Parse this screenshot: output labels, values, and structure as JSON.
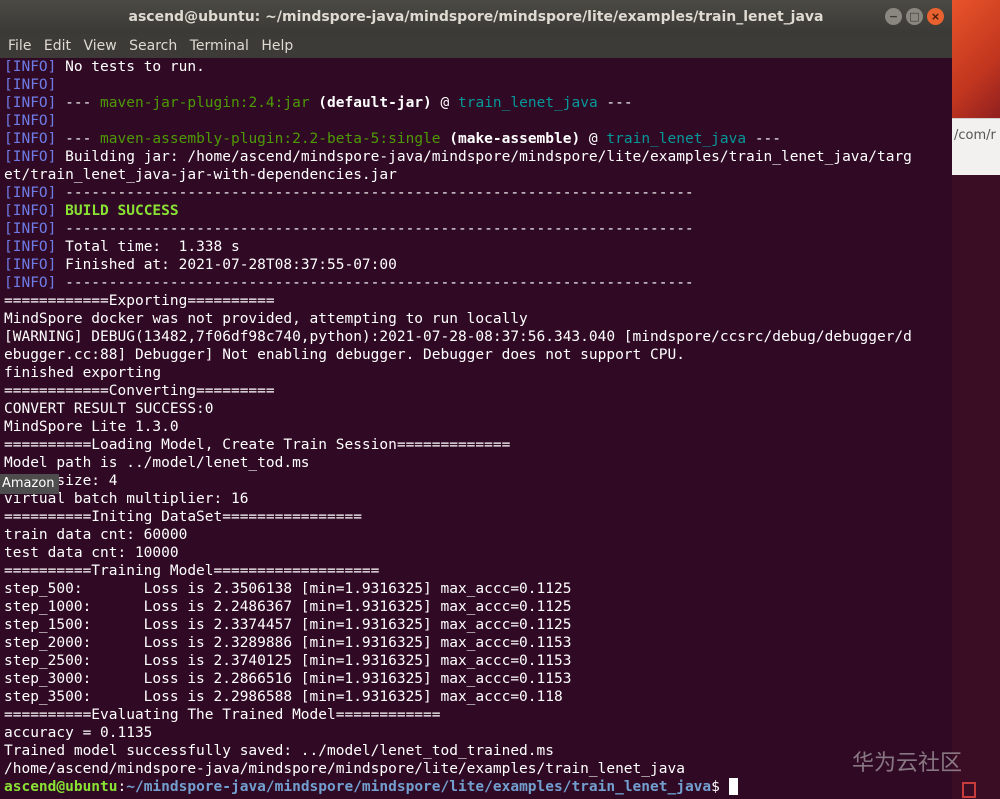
{
  "window": {
    "title": "ascend@ubuntu: ~/mindspore-java/mindspore/mindspore/lite/examples/train_lenet_java",
    "buttons": [
      "−",
      "□",
      "×"
    ]
  },
  "menu": [
    "File",
    "Edit",
    "View",
    "Search",
    "Terminal",
    "Help"
  ],
  "background": {
    "url_fragment": "/com/r"
  },
  "overlay_label": "Amazon",
  "watermark": "华为云社区",
  "lines": [
    [
      [
        "info",
        "[INFO]"
      ],
      [
        "t",
        " No tests to run."
      ]
    ],
    [
      [
        "info",
        "[INFO]"
      ]
    ],
    [
      [
        "info",
        "[INFO]"
      ],
      [
        "t",
        " --- "
      ],
      [
        "green",
        "maven-jar-plugin:2.4:jar"
      ],
      [
        "t",
        " "
      ],
      [
        "bold",
        "(default-jar)"
      ],
      [
        "t",
        " @ "
      ],
      [
        "cyan",
        "train_lenet_java"
      ],
      [
        "t",
        " ---"
      ]
    ],
    [
      [
        "info",
        "[INFO]"
      ]
    ],
    [
      [
        "info",
        "[INFO]"
      ],
      [
        "t",
        " --- "
      ],
      [
        "green",
        "maven-assembly-plugin:2.2-beta-5:single"
      ],
      [
        "t",
        " "
      ],
      [
        "bold",
        "(make-assemble)"
      ],
      [
        "t",
        " @ "
      ],
      [
        "cyan",
        "train_lenet_java"
      ],
      [
        "t",
        " ---"
      ]
    ],
    [
      [
        "info",
        "[INFO]"
      ],
      [
        "t",
        " Building jar: /home/ascend/mindspore-java/mindspore/mindspore/lite/examples/train_lenet_java/targ"
      ]
    ],
    [
      [
        "t",
        "et/train_lenet_java-jar-with-dependencies.jar"
      ]
    ],
    [
      [
        "info",
        "[INFO]"
      ],
      [
        "t",
        " ------------------------------------------------------------------------"
      ]
    ],
    [
      [
        "info",
        "[INFO]"
      ],
      [
        "t",
        " "
      ],
      [
        "lgreen",
        "BUILD SUCCESS"
      ]
    ],
    [
      [
        "info",
        "[INFO]"
      ],
      [
        "t",
        " ------------------------------------------------------------------------"
      ]
    ],
    [
      [
        "info",
        "[INFO]"
      ],
      [
        "t",
        " Total time:  1.338 s"
      ]
    ],
    [
      [
        "info",
        "[INFO]"
      ],
      [
        "t",
        " Finished at: 2021-07-28T08:37:55-07:00"
      ]
    ],
    [
      [
        "info",
        "[INFO]"
      ],
      [
        "t",
        " ------------------------------------------------------------------------"
      ]
    ],
    [
      [
        "t",
        "============Exporting=========="
      ]
    ],
    [
      [
        "t",
        "MindSpore docker was not provided, attempting to run locally"
      ]
    ],
    [
      [
        "t",
        "[WARNING] DEBUG(13482,7f06df98c740,python):2021-07-28-08:37:56.343.040 [mindspore/ccsrc/debug/debugger/d"
      ]
    ],
    [
      [
        "t",
        "ebugger.cc:88] Debugger] Not enabling debugger. Debugger does not support CPU."
      ]
    ],
    [
      [
        "t",
        "finished exporting"
      ]
    ],
    [
      [
        "t",
        "============Converting========="
      ]
    ],
    [
      [
        "t",
        "CONVERT RESULT SUCCESS:0"
      ]
    ],
    [
      [
        "t",
        "MindSpore Lite 1.3.0"
      ]
    ],
    [
      [
        "t",
        "==========Loading Model, Create Train Session============="
      ]
    ],
    [
      [
        "t",
        "Model path is ../model/lenet_tod.ms"
      ]
    ],
    [
      [
        "t",
        "batch size: 4"
      ]
    ],
    [
      [
        "t",
        "virtual batch multiplier: 16"
      ]
    ],
    [
      [
        "t",
        "==========Initing DataSet================"
      ]
    ],
    [
      [
        "t",
        "train data cnt: 60000"
      ]
    ],
    [
      [
        "t",
        "test data cnt: 10000"
      ]
    ],
    [
      [
        "t",
        "==========Training Model==================="
      ]
    ],
    [
      [
        "t",
        "step_500:       Loss is 2.3506138 [min=1.9316325] max_accc=0.1125"
      ]
    ],
    [
      [
        "t",
        "step_1000:      Loss is 2.2486367 [min=1.9316325] max_accc=0.1125"
      ]
    ],
    [
      [
        "t",
        "step_1500:      Loss is 2.3374457 [min=1.9316325] max_accc=0.1125"
      ]
    ],
    [
      [
        "t",
        "step_2000:      Loss is 2.3289886 [min=1.9316325] max_accc=0.1153"
      ]
    ],
    [
      [
        "t",
        "step_2500:      Loss is 2.3740125 [min=1.9316325] max_accc=0.1153"
      ]
    ],
    [
      [
        "t",
        "step_3000:      Loss is 2.2866516 [min=1.9316325] max_accc=0.1153"
      ]
    ],
    [
      [
        "t",
        "step_3500:      Loss is 2.2986588 [min=1.9316325] max_accc=0.118"
      ]
    ],
    [
      [
        "t",
        "==========Evaluating The Trained Model============"
      ]
    ],
    [
      [
        "t",
        "accuracy = 0.1135"
      ]
    ],
    [
      [
        "t",
        "Trained model successfully saved: ../model/lenet_tod_trained.ms"
      ]
    ],
    [
      [
        "t",
        "/home/ascend/mindspore-java/mindspore/mindspore/lite/examples/train_lenet_java"
      ]
    ],
    [
      [
        "puser",
        "ascend@ubuntu"
      ],
      [
        "t",
        ":"
      ],
      [
        "ppath",
        "~/mindspore-java/mindspore/mindspore/lite/examples/train_lenet_java"
      ],
      [
        "t",
        "$ "
      ],
      [
        "cursor",
        ""
      ]
    ]
  ]
}
